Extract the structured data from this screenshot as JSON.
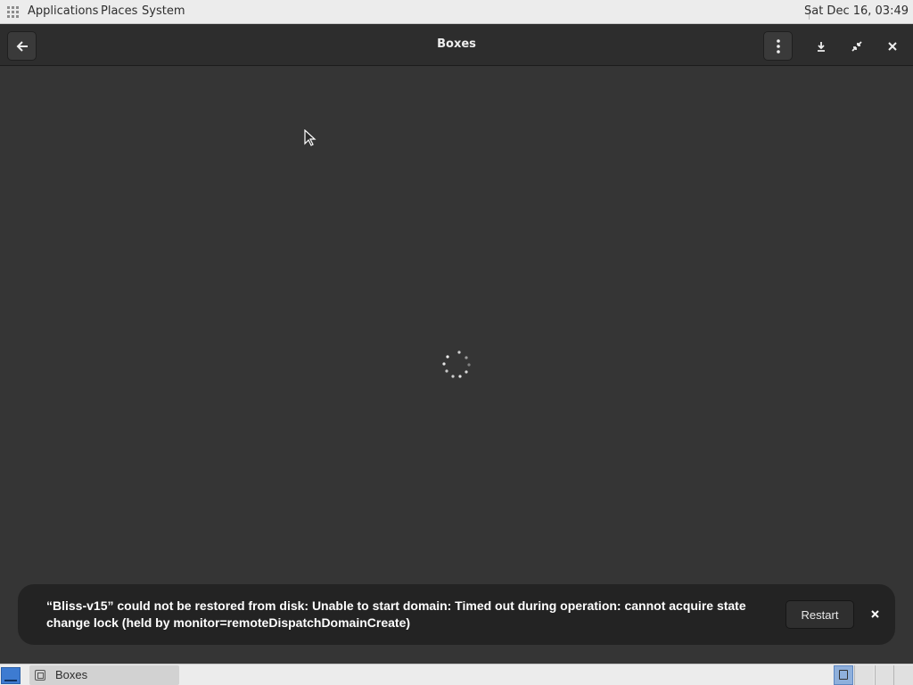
{
  "top_panel": {
    "menus": [
      "Applications",
      "Places",
      "System"
    ],
    "clock": "Sat Dec 16, 03:49"
  },
  "window": {
    "title": "Boxes",
    "state": "loading"
  },
  "notification": {
    "message": "“Bliss-v15” could not be restored from disk: Unable to start domain: Timed out during operation: cannot acquire state change lock (held by monitor=remoteDispatchDomainCreate)",
    "action_label": "Restart"
  },
  "taskbar": {
    "tasks": [
      {
        "label": "Boxes"
      }
    ],
    "workspaces": 4,
    "active_workspace": 1
  },
  "icons": {
    "apps": "apps-grid-icon",
    "back": "back-arrow-icon",
    "menu": "kebab-menu-icon",
    "download": "download-icon",
    "fullscreen": "fullscreen-icon",
    "close": "close-icon",
    "spinner": "loading-spinner-icon",
    "cursor": "mouse-pointer-icon"
  },
  "colors": {
    "window_bg": "#353535",
    "headerbar_bg": "#2d2d2d",
    "notification_bg": "#232323",
    "panel_bg": "#ececec",
    "workspace_active": "#8fb0dc",
    "show_desktop": "#3d7bd1"
  }
}
